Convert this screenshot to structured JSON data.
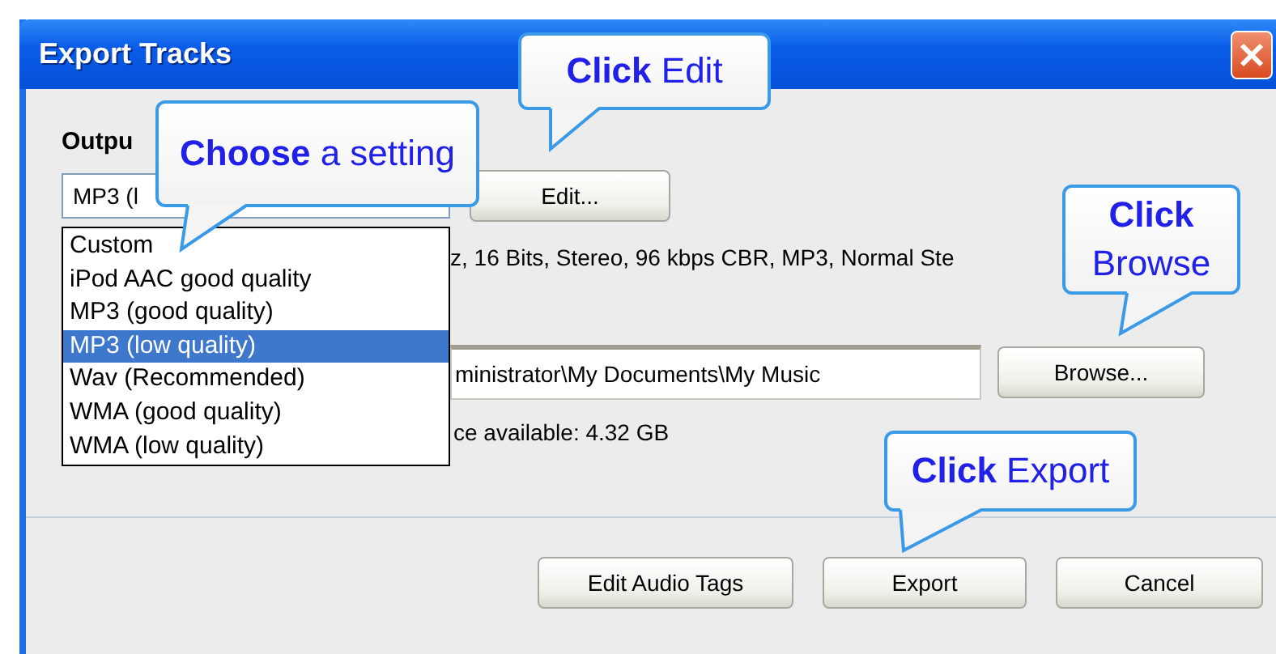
{
  "window": {
    "title": "Export Tracks"
  },
  "output_label": "Outpu",
  "format_select": {
    "value": "MP3 (l"
  },
  "edit_button": "Edit...",
  "format_info": "z, 16 Bits, Stereo, 96 kbps CBR, MP3, Normal Ste",
  "format_options": [
    {
      "label": "Custom",
      "selected": false
    },
    {
      "label": "iPod AAC good quality",
      "selected": false
    },
    {
      "label": "MP3 (good quality)",
      "selected": false
    },
    {
      "label": "MP3 (low quality)",
      "selected": true
    },
    {
      "label": "Wav (Recommended)",
      "selected": false
    },
    {
      "label": "WMA (good quality)",
      "selected": false
    },
    {
      "label": "WMA (low quality)",
      "selected": false
    }
  ],
  "folder_field": {
    "value": "ministrator\\My Documents\\My Music"
  },
  "browse_button": "Browse...",
  "free_space": "ce available: 4.32 GB",
  "buttons": [
    "Edit Audio Tags",
    "Export",
    "Cancel"
  ],
  "callouts": [
    {
      "text": "**Click** Edit"
    },
    {
      "text": "**Choose** a setting"
    },
    {
      "text": "**Click** Browse"
    },
    {
      "text": "**Click** Export"
    }
  ]
}
